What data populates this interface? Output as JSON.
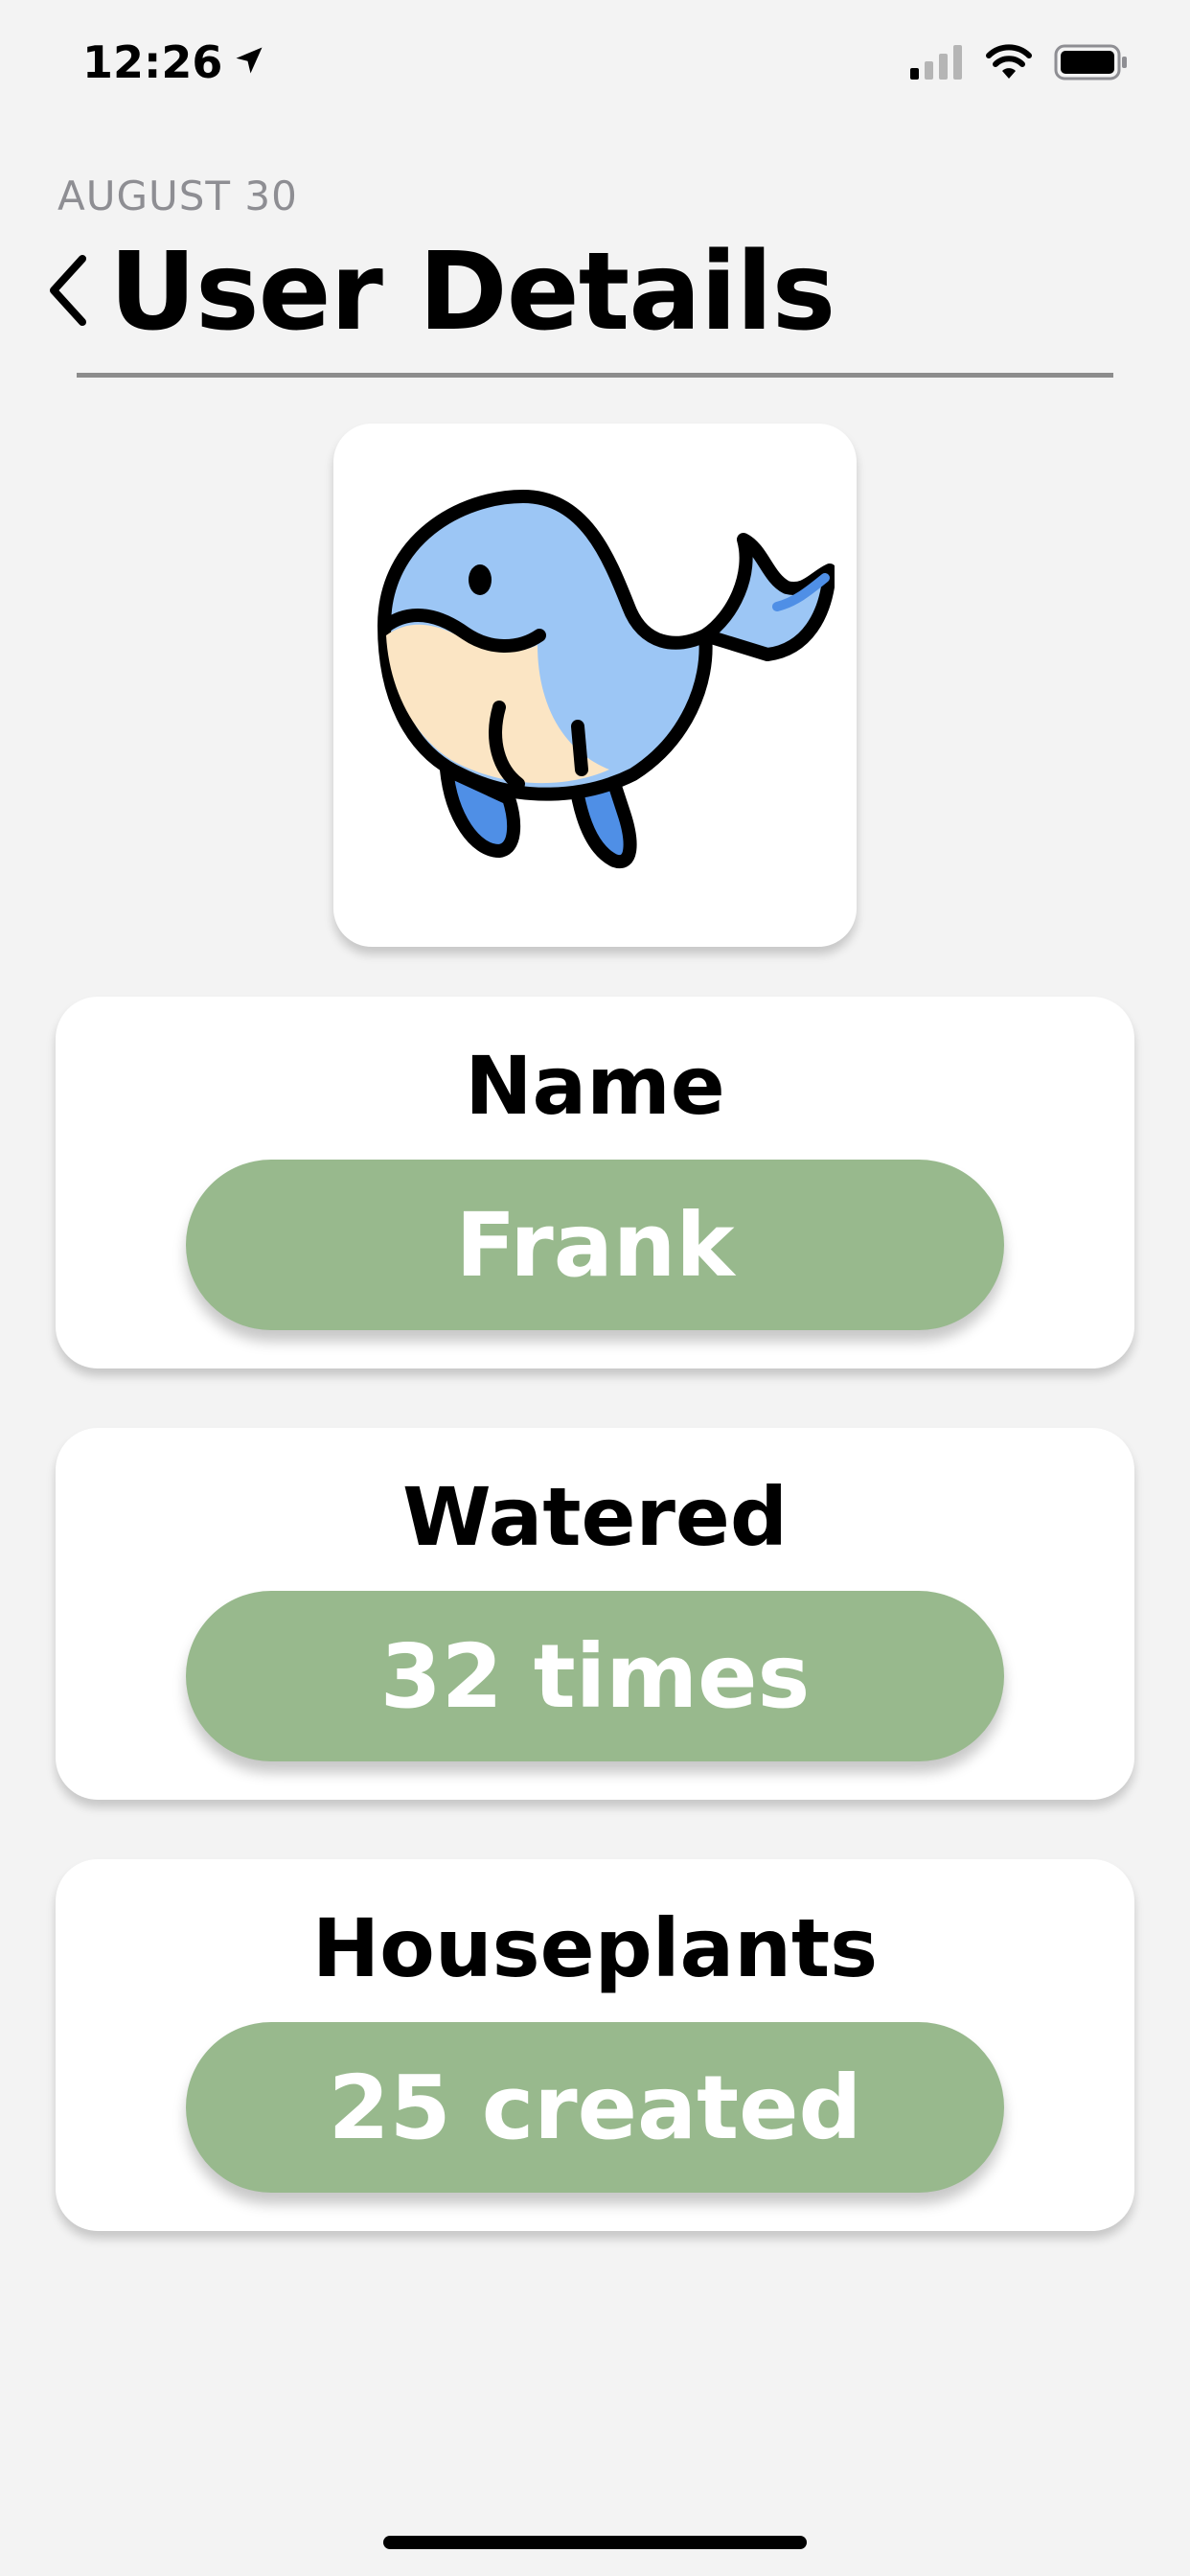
{
  "status_bar": {
    "time": "12:26",
    "location_icon": "location-arrow-icon",
    "signal_icon": "cellular-signal-icon",
    "wifi_icon": "wifi-icon",
    "battery_icon": "battery-icon"
  },
  "header": {
    "date": "AUGUST 30",
    "back_icon": "chevron-left-icon",
    "title": "User Details"
  },
  "avatar": {
    "icon": "whale-icon"
  },
  "cards": [
    {
      "label": "Name",
      "value": "Frank"
    },
    {
      "label": "Watered",
      "value": "32 times"
    },
    {
      "label": "Houseplants",
      "value": "25 created"
    }
  ],
  "colors": {
    "background": "#f3f3f3",
    "pill_green": "#98b98d",
    "whale_blue": "#9cc6f5",
    "whale_belly": "#fbe5c4",
    "whale_fin": "#4f8fe6"
  }
}
